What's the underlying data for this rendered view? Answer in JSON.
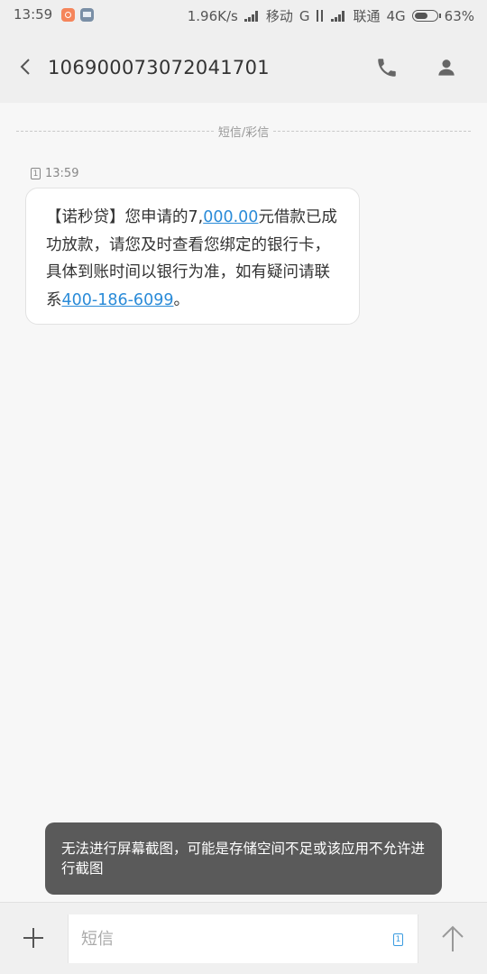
{
  "status_bar": {
    "time": "13:59",
    "speed": "1.96K/s",
    "carrier1": "移动",
    "net1": "G",
    "carrier2": "联通",
    "net2": "4G",
    "battery": "63%",
    "battery_level": 0.63
  },
  "header": {
    "title": "106900073072041701"
  },
  "divider": {
    "label": "短信/彩信"
  },
  "message": {
    "sim": "1",
    "time": "13:59",
    "part1": "【诺秒贷】您申请的7,",
    "amount_link": "000.00",
    "part2": "元借款已成功放款，请您及时查看您绑定的银行卡，具体到账时间以银行为准，如有疑问请联系",
    "phone_link": "400-186-6099",
    "part3": "。"
  },
  "toast": {
    "text": "无法进行屏幕截图，可能是存储空间不足或该应用不允许进行截图"
  },
  "composer": {
    "placeholder": "短信",
    "value": "",
    "sim": "1"
  },
  "colors": {
    "link": "#2a8bd8",
    "toast_bg": "#5a5a5a",
    "header_bg": "#efefef"
  }
}
